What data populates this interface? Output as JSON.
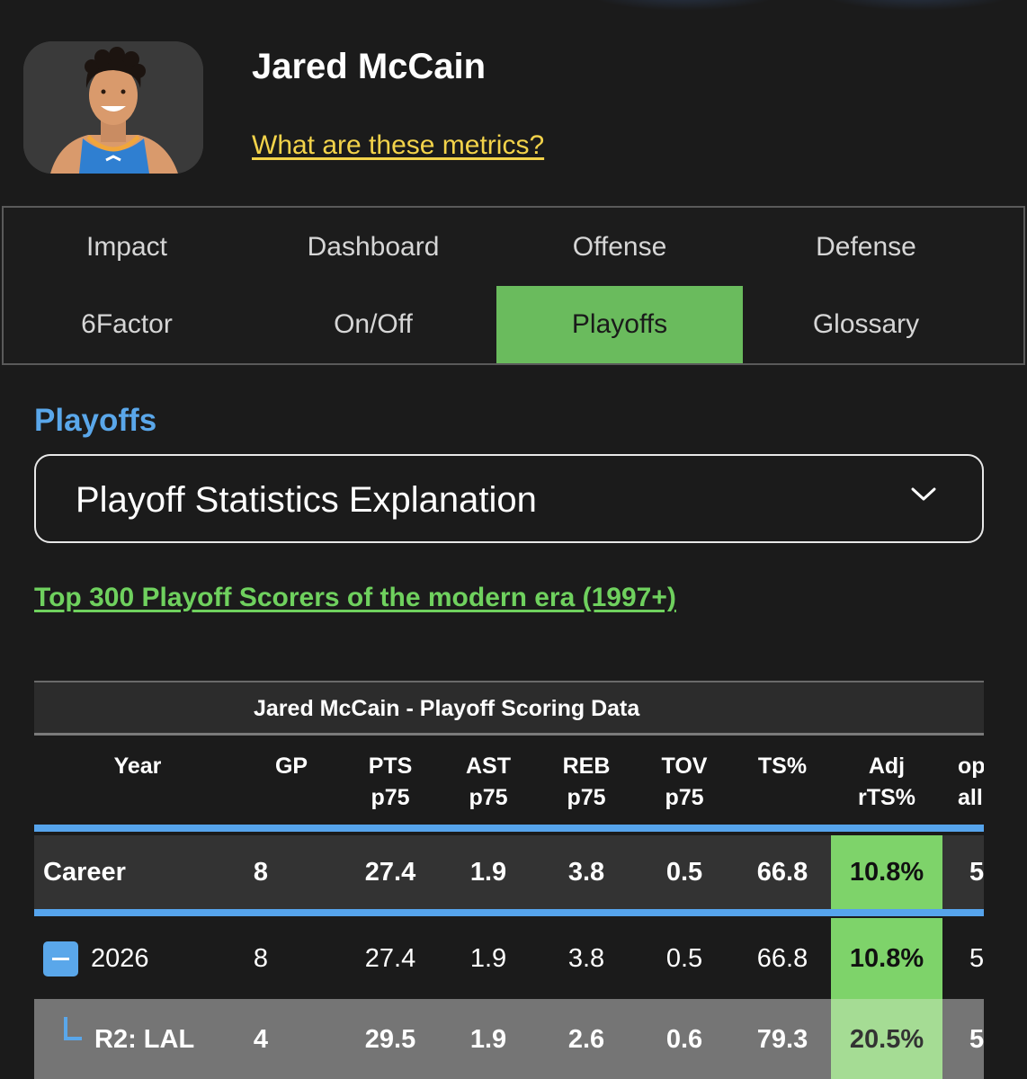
{
  "player": {
    "name": "Jared McCain",
    "metrics_link": "What are these metrics?"
  },
  "tabs": [
    {
      "label": "Impact",
      "active": false
    },
    {
      "label": "Dashboard",
      "active": false
    },
    {
      "label": "Offense",
      "active": false
    },
    {
      "label": "Defense",
      "active": false
    },
    {
      "label": "6Factor",
      "active": false
    },
    {
      "label": "On/Off",
      "active": false
    },
    {
      "label": "Playoffs",
      "active": true
    },
    {
      "label": "Glossary",
      "active": false
    }
  ],
  "section": {
    "title": "Playoffs",
    "accordion_label": "Playoff Statistics Explanation",
    "top_scorers_link": "Top 300 Playoff Scorers of the modern era (1997+)"
  },
  "table": {
    "caption": "Jared McCain - Playoff Scoring Data",
    "headers": {
      "year": "Year",
      "gp": "GP",
      "pts": [
        "PTS",
        "p75"
      ],
      "ast": [
        "AST",
        "p75"
      ],
      "reb": [
        "REB",
        "p75"
      ],
      "tov": [
        "TOV",
        "p75"
      ],
      "ts": "TS%",
      "adj": [
        "Adj",
        "rTS%"
      ],
      "opp": [
        "op",
        "all"
      ]
    },
    "rows": {
      "career": {
        "label": "Career",
        "gp": "8",
        "pts": "27.4",
        "ast": "1.9",
        "reb": "3.8",
        "tov": "0.5",
        "ts": "66.8",
        "adj": "10.8%",
        "opp": "5"
      },
      "season": {
        "label": "2026",
        "gp": "8",
        "pts": "27.4",
        "ast": "1.9",
        "reb": "3.8",
        "tov": "0.5",
        "ts": "66.8",
        "adj": "10.8%",
        "opp": "5"
      },
      "series": {
        "label": "R2: LAL",
        "gp": "4",
        "pts": "29.5",
        "ast": "1.9",
        "reb": "2.6",
        "tov": "0.6",
        "ts": "79.3",
        "adj": "20.5%",
        "opp": "5"
      }
    }
  },
  "colors": {
    "accent_blue": "#5aa7ea",
    "active_tab_green": "#6abb5d",
    "metrics_link_yellow": "#f3d34a",
    "scorers_link_green": "#6fd15e",
    "adj_highlight": "#7ed36a"
  }
}
